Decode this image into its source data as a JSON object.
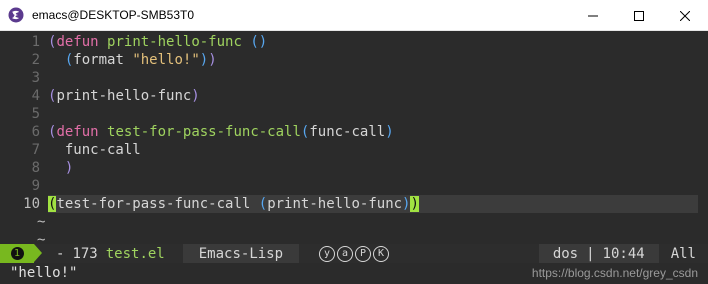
{
  "window": {
    "title": "emacs@DESKTOP-SMB53T0",
    "controls": [
      "minimize",
      "maximize",
      "close"
    ]
  },
  "editor": {
    "lines": [
      {
        "n": "1"
      },
      {
        "n": "2"
      },
      {
        "n": "3"
      },
      {
        "n": "4"
      },
      {
        "n": "5"
      },
      {
        "n": "6"
      },
      {
        "n": "7"
      },
      {
        "n": "8"
      },
      {
        "n": "9"
      },
      {
        "n": "10"
      }
    ],
    "tokens": {
      "defun": "defun",
      "print_hello_func": "print-hello-func",
      "empty_args": "()",
      "format": "format",
      "hello_str": "\"hello!\"",
      "call_print": "print-hello-func",
      "test_fn": "test-for-pass-func-call",
      "arg": "func-call",
      "body": "func-call"
    },
    "empty_marker": "~"
  },
  "modeline": {
    "state_glyph": "1",
    "modified_flag": "-",
    "size": "173",
    "buffer_name": "test.el",
    "major_mode": "Emacs-Lisp",
    "minor_modes": [
      "y",
      "a",
      "P",
      "K"
    ],
    "encoding": "dos",
    "separator": "|",
    "position": "10:44",
    "scroll": "All"
  },
  "echo": {
    "message": "\"hello!\"",
    "watermark": "https://blog.csdn.net/grey_csdn"
  },
  "colors": {
    "background": "#2b2b2b",
    "keyword": "#e26fa8",
    "function_name": "#9fd35f",
    "string": "#e3c07b",
    "outer_paren": "#a68fe0",
    "inner_paren": "#58a7f0",
    "state_green": "#78b81f"
  }
}
